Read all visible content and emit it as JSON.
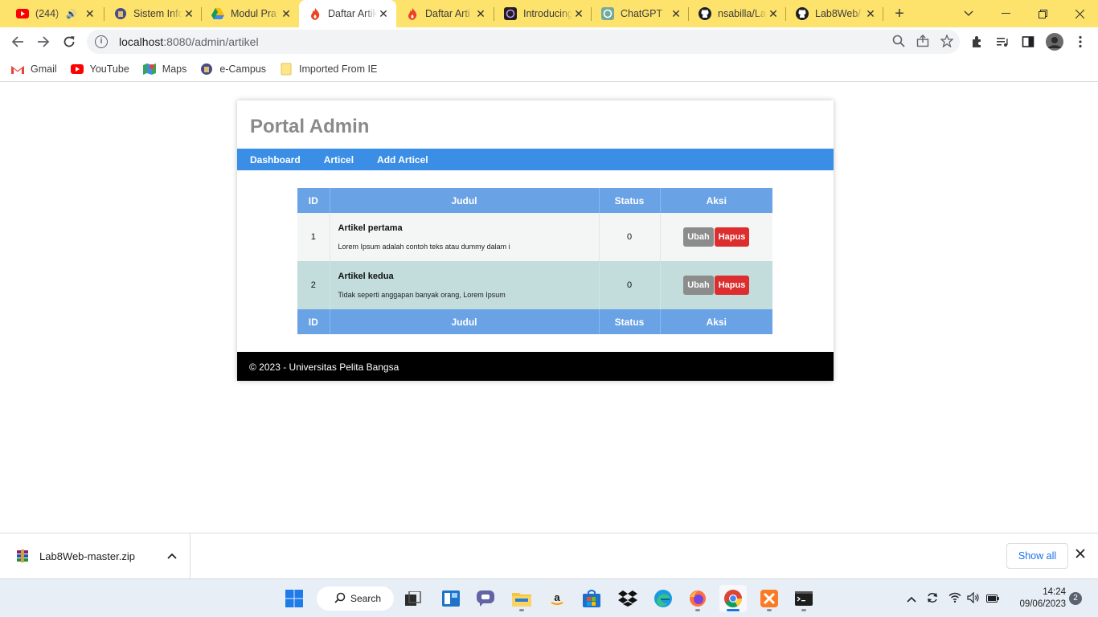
{
  "browser": {
    "tabs": [
      {
        "title": "(244) S",
        "icon": "youtube-icon",
        "close": "✕"
      },
      {
        "title": "Sistem Infor",
        "icon": "campus-icon",
        "close": "✕"
      },
      {
        "title": "Modul Pra",
        "icon": "drive-icon",
        "close": "✕"
      },
      {
        "title": "Daftar Artik",
        "icon": "codeigniter-icon",
        "close": "✕"
      },
      {
        "title": "Daftar Arti",
        "icon": "codeigniter-icon",
        "close": "✕"
      },
      {
        "title": "Introducing",
        "icon": "openai-icon",
        "close": "✕"
      },
      {
        "title": "ChatGPT",
        "icon": "chatgpt-icon",
        "close": "✕"
      },
      {
        "title": "nsabilla/La",
        "icon": "github-icon",
        "close": "✕"
      },
      {
        "title": "Lab8Web/",
        "icon": "github-icon",
        "close": "✕"
      }
    ],
    "url_host": "localhost",
    "url_path": ":8080/admin/artikel",
    "bookmarks": [
      {
        "label": "Gmail",
        "icon": "gmail-icon"
      },
      {
        "label": "YouTube",
        "icon": "youtube-icon"
      },
      {
        "label": "Maps",
        "icon": "maps-icon"
      },
      {
        "label": "e-Campus",
        "icon": "campus-icon"
      },
      {
        "label": "Imported From IE",
        "icon": "folder-icon"
      }
    ]
  },
  "page": {
    "header_title": "Portal Admin",
    "nav": [
      "Dashboard",
      "Articel",
      "Add Articel"
    ],
    "table": {
      "headers": [
        "ID",
        "Judul",
        "Status",
        "Aksi"
      ],
      "rows": [
        {
          "id": "1",
          "title": "Artikel pertama",
          "desc": "Lorem Ipsum adalah contoh teks atau dummy dalam i",
          "status": "0"
        },
        {
          "id": "2",
          "title": "Artikel kedua",
          "desc": "Tidak seperti anggapan banyak orang, Lorem Ipsum",
          "status": "0"
        }
      ],
      "edit_label": "Ubah",
      "delete_label": "Hapus"
    },
    "footer": "© 2023 - Universitas Pelita Bangsa"
  },
  "downloads": {
    "file": "Lab8Web-master.zip",
    "show_all": "Show all"
  },
  "taskbar": {
    "search_label": "Search",
    "time": "14:24",
    "date": "09/06/2023",
    "notification_count": "2"
  },
  "colors": {
    "tabstrip": "#fde26b",
    "nav": "#3a8ee6",
    "table_header": "#6aa2e6",
    "row_alt": "#c3dcdc",
    "delete": "#dc2e2e",
    "edit": "#8c8c8c",
    "footer": "#000000"
  }
}
